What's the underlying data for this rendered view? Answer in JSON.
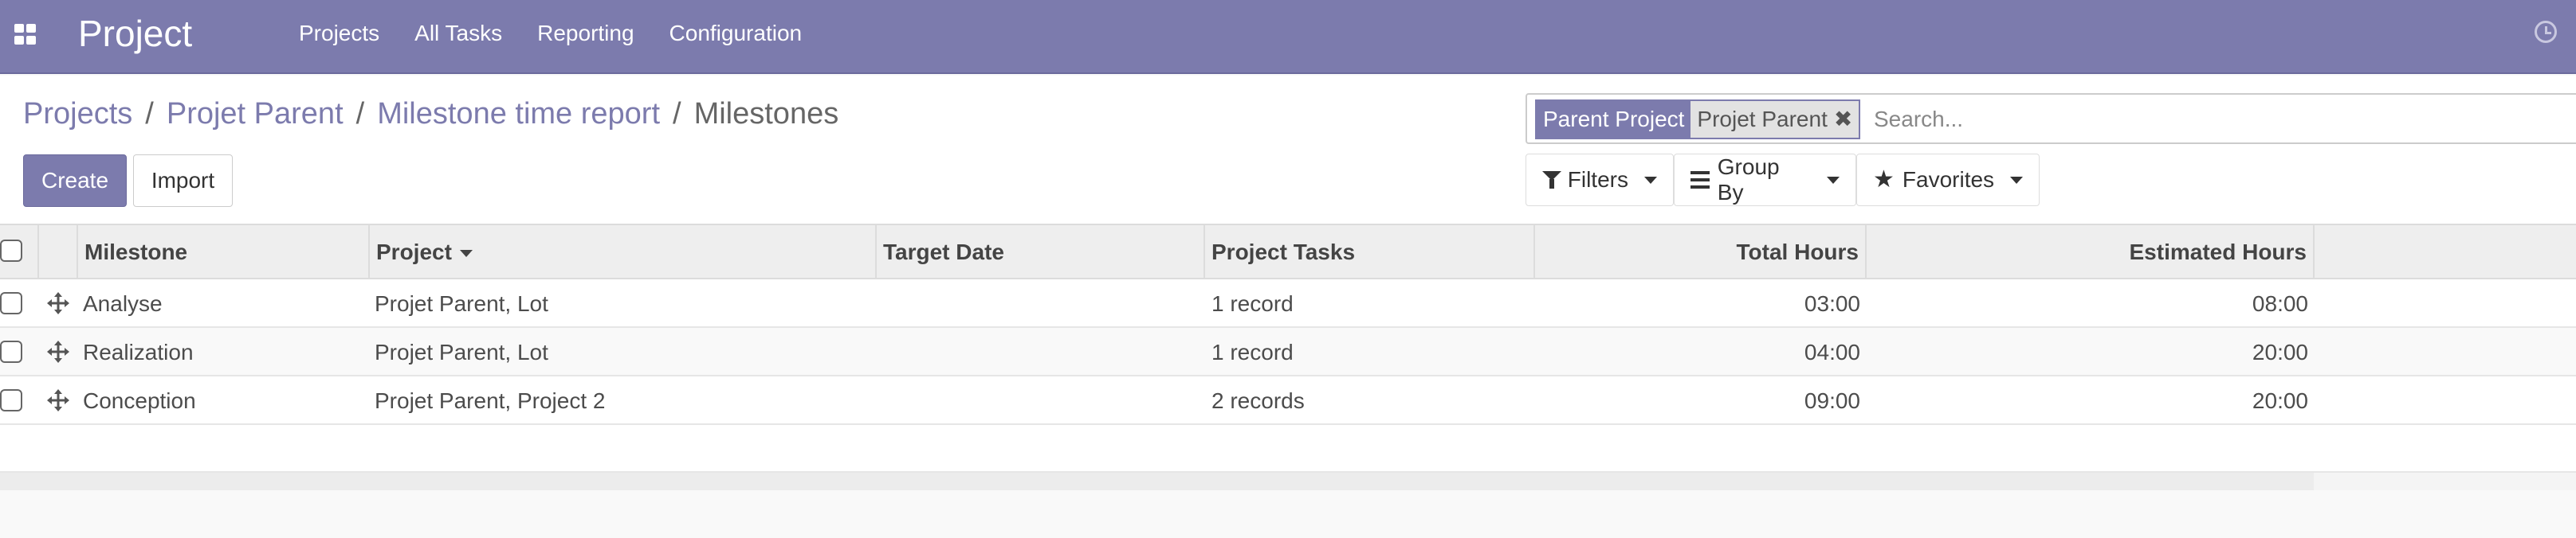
{
  "navbar": {
    "brand": "Project",
    "menu": [
      "Projects",
      "All Tasks",
      "Reporting",
      "Configuration"
    ]
  },
  "breadcrumb": {
    "links": [
      "Projects",
      "Projet Parent",
      "Milestone time report"
    ],
    "separator": "/",
    "active": "Milestones"
  },
  "buttons": {
    "create": "Create",
    "import": "Import"
  },
  "search": {
    "facet_label": "Parent Project",
    "facet_value": "Projet Parent",
    "facet_remove": "✖",
    "placeholder": "Search...",
    "filters": "Filters",
    "group_by": "Group By",
    "favorites": "Favorites"
  },
  "table": {
    "columns": [
      "Milestone",
      "Project",
      "Target Date",
      "Project Tasks",
      "Total Hours",
      "Estimated Hours"
    ],
    "rows": [
      {
        "milestone": "Analyse",
        "project": "Projet Parent, Lot",
        "target_date": "",
        "tasks": "1 record",
        "total_hours": "03:00",
        "estimated_hours": "08:00"
      },
      {
        "milestone": "Realization",
        "project": "Projet Parent, Lot",
        "target_date": "",
        "tasks": "1 record",
        "total_hours": "04:00",
        "estimated_hours": "20:00"
      },
      {
        "milestone": "Conception",
        "project": "Projet Parent, Project 2",
        "target_date": "",
        "tasks": "2 records",
        "total_hours": "09:00",
        "estimated_hours": "20:00"
      }
    ]
  },
  "colors": {
    "brand": "#7c7bad",
    "header_bg": "#eeeeee"
  }
}
